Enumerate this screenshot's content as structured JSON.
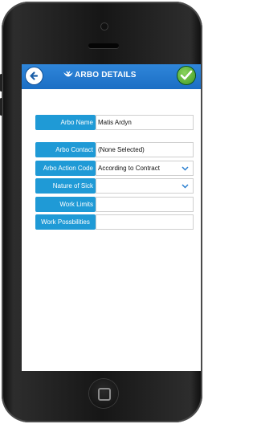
{
  "header": {
    "title": "ARBO DETAILS"
  },
  "form": {
    "rows": [
      {
        "label": "Arbo Name",
        "value": "Matis Ardyn"
      },
      {
        "label": "Arbo Contact",
        "value": "(None Selected)"
      },
      {
        "label": "Arbo Action Code",
        "value": "According to Contract"
      },
      {
        "label": "Nature of Sick",
        "value": ""
      },
      {
        "label": "Work Limits",
        "value": ""
      },
      {
        "label": "Work Possbilities",
        "value": ""
      }
    ]
  },
  "colors": {
    "topbar": "#1b6ec4",
    "label_bg": "#1f9ad6",
    "confirm": "#3e9a23"
  },
  "icons": {
    "back": "arrow-left-icon",
    "logo": "arbo-logo-icon",
    "confirm": "checkmark-icon",
    "dropdown": "chevron-down-icon"
  }
}
